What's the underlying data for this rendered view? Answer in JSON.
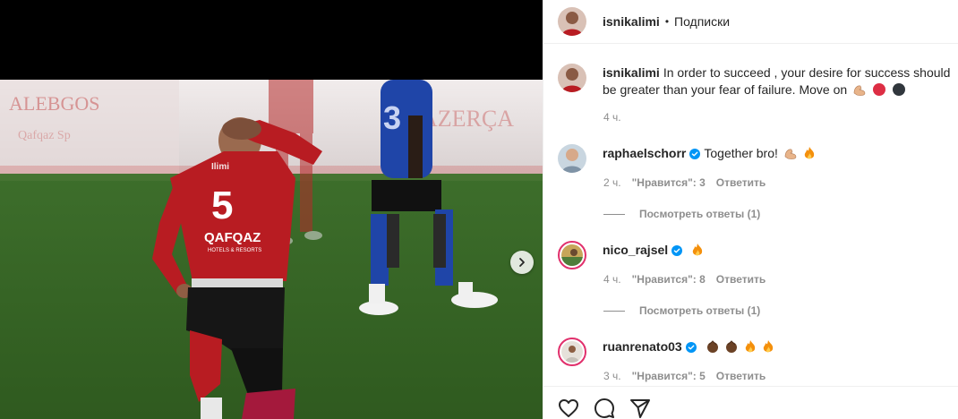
{
  "header": {
    "username": "isnikalimi",
    "separator": "•",
    "follow_label": "Подписки"
  },
  "caption": {
    "username": "isnikalimi",
    "text": "In order to succeed , your desire for success should be greater than your fear of failure. Move on",
    "emojis": [
      "flexed-biceps",
      "red-circle",
      "black-circle"
    ],
    "time": "4 ч."
  },
  "photo": {
    "jersey_name": "Ilimi",
    "jersey_number": "5",
    "sponsor": "QAFQAZ",
    "sponsor_sub": "HOTELS & RESORTS"
  },
  "comments": [
    {
      "username": "raphaelschorr",
      "verified": true,
      "text": "Together bro!",
      "emojis": [
        "flexed-biceps",
        "fire"
      ],
      "time": "2 ч.",
      "likes": "\"Нравится\": 3",
      "reply_label": "Ответить",
      "view_replies": "Посмотреть ответы (1)"
    },
    {
      "username": "nico_rajsel",
      "verified": true,
      "text": "",
      "emojis": [
        "fire"
      ],
      "time": "4 ч.",
      "likes": "\"Нравится\": 8",
      "reply_label": "Ответить",
      "view_replies": "Посмотреть ответы (1)"
    },
    {
      "username": "ruanrenato03",
      "verified": true,
      "text": "",
      "emojis": [
        "clapping-hands-dark",
        "clapping-hands-dark",
        "fire",
        "fire"
      ],
      "time": "3 ч.",
      "likes": "\"Нравится\": 5",
      "reply_label": "Ответить",
      "view_replies": ""
    }
  ],
  "actions": [
    "heart-icon",
    "comment-icon",
    "share-icon"
  ],
  "colors": {
    "text": "#262626",
    "secondary": "#8e8e8e",
    "border": "#efefef",
    "verified": "#0095f6",
    "jersey_red": "#b81c22"
  }
}
